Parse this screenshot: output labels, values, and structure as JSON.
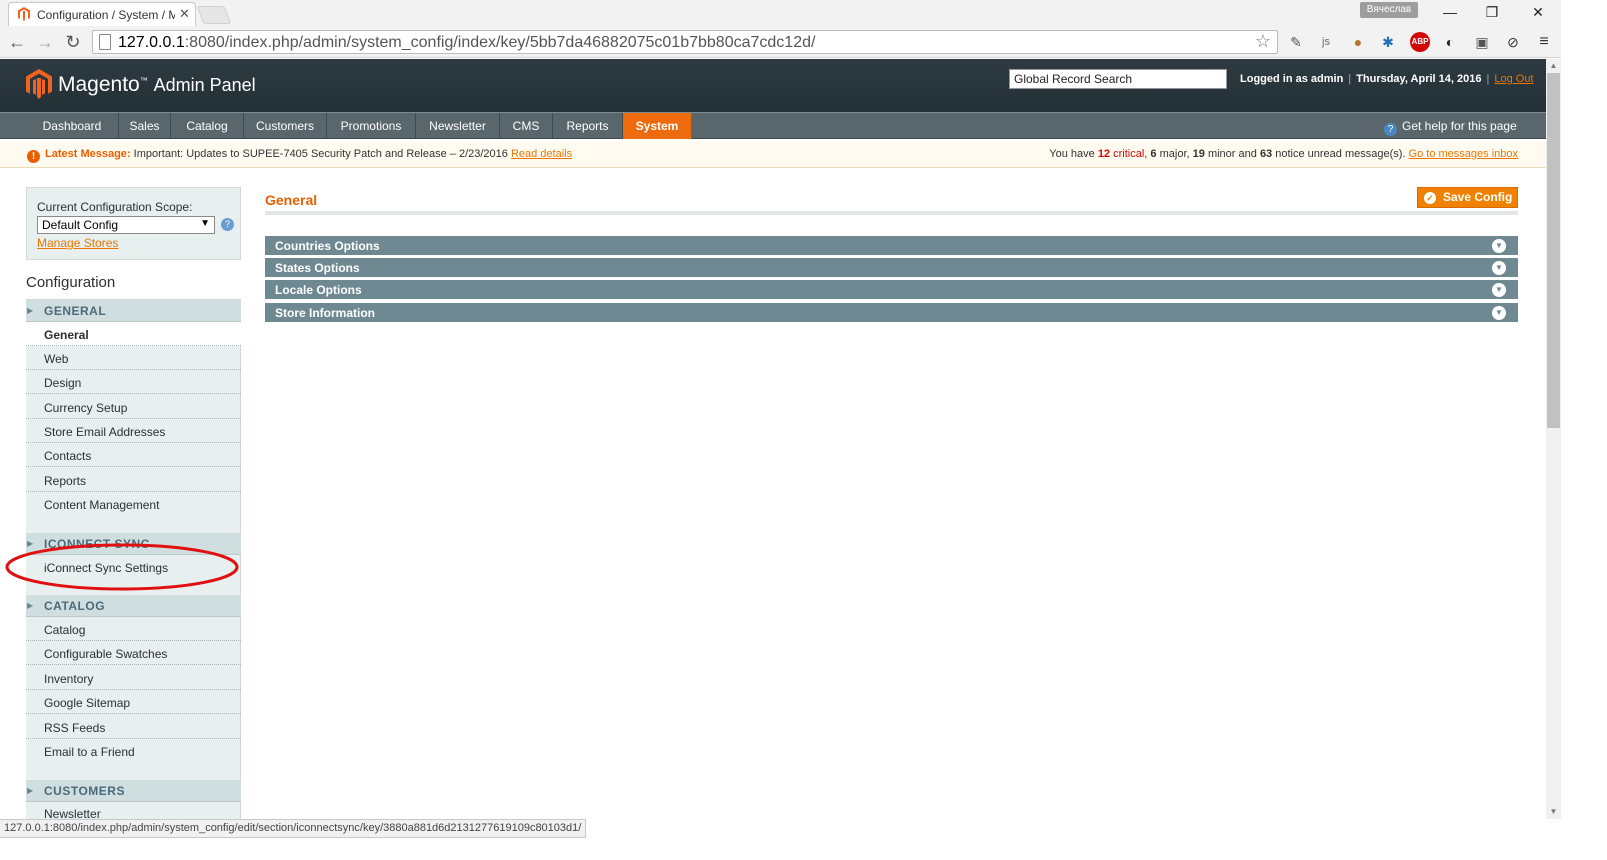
{
  "browser": {
    "tab_title": "Configuration / System / M",
    "user_badge": "Вячеслав",
    "url_host": "127.0.0.1",
    "url_rest": ":8080/index.php/admin/system_config/index/key/5bb7da46882075c01b7bb80ca7cdc12d/",
    "status_url": "127.0.0.1:8080/index.php/admin/system_config/edit/section/iconnectsync/key/3880a881d6d2131277619109c80103d1/",
    "ext_js_label": "js",
    "ext_abp_label": "ABP"
  },
  "header": {
    "logo_main": "Magento",
    "logo_sub": "Admin Panel",
    "search_value": "Global Record Search",
    "logged_in": "Logged in as admin",
    "date": "Thursday, April 14, 2016",
    "logout": "Log Out"
  },
  "nav": {
    "items": [
      "Dashboard",
      "Sales",
      "Catalog",
      "Customers",
      "Promotions",
      "Newsletter",
      "CMS",
      "Reports",
      "System"
    ],
    "active": "System",
    "help": "Get help for this page"
  },
  "message": {
    "label": "Latest Message:",
    "text": "Important: Updates to SUPEE-7405 Security Patch and Release – 2/23/2016",
    "link": "Read details",
    "summary_pre": "You have",
    "critical_count": "12",
    "critical_label": "critical",
    "major_count": "6",
    "major_label": "major,",
    "minor_count": "19",
    "minor_label": "minor and",
    "notice_count": "63",
    "notice_label": "notice unread message(s).",
    "inbox_link": "Go to messages inbox"
  },
  "sidebar": {
    "scope_label": "Current Configuration Scope:",
    "scope_value": "Default Config",
    "manage_stores": "Manage Stores",
    "config_title": "Configuration",
    "sections": [
      {
        "title": "GENERAL",
        "items": [
          "General",
          "Web",
          "Design",
          "Currency Setup",
          "Store Email Addresses",
          "Contacts",
          "Reports",
          "Content Management"
        ]
      },
      {
        "title": "ICONNECT SYNC",
        "items": [
          "iConnect Sync Settings"
        ]
      },
      {
        "title": "CATALOG",
        "items": [
          "Catalog",
          "Configurable Swatches",
          "Inventory",
          "Google Sitemap",
          "RSS Feeds",
          "Email to a Friend"
        ]
      },
      {
        "title": "CUSTOMERS",
        "items": [
          "Newsletter"
        ]
      }
    ],
    "active_item": "General"
  },
  "main": {
    "title": "General",
    "save_button": "Save Config",
    "fieldsets": [
      "Countries Options",
      "States Options",
      "Locale Options",
      "Store Information"
    ]
  },
  "colors": {
    "accent_orange": "#ee6b0d",
    "header_bg": "#2e3b42",
    "nav_bg": "#59676d",
    "fieldset_bg": "#6f8992",
    "annotation_red": "#e01010"
  }
}
